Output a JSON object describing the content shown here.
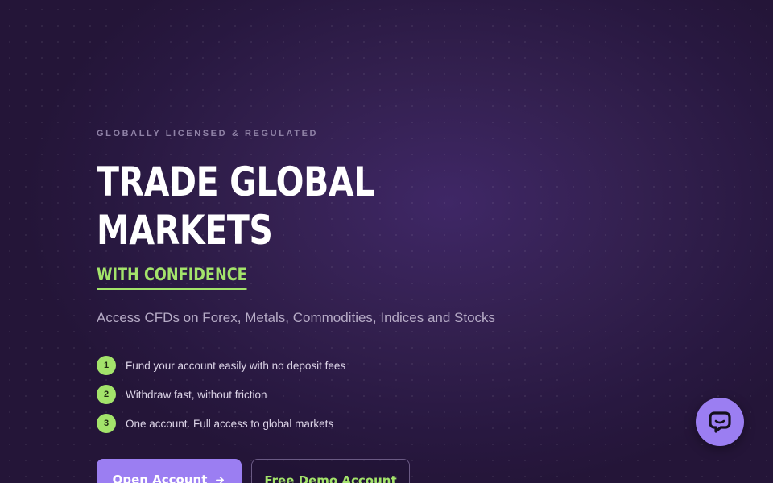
{
  "hero": {
    "eyebrow": "GLOBALLY LICENSED & REGULATED",
    "headline_line1": "TRADE GLOBAL",
    "headline_line2": "MARKETS",
    "tagline": "WITH CONFIDENCE",
    "subtitle": "Access CFDs on Forex, Metals, Commodities, Indices and Stocks",
    "features": [
      {
        "number": "1",
        "text": "Fund your account easily with no deposit fees"
      },
      {
        "number": "2",
        "text": "Withdraw fast, without friction"
      },
      {
        "number": "3",
        "text": "One account. Full access to global markets"
      }
    ],
    "primary_button": {
      "label": "Open Account",
      "icon": "arrow-right-icon"
    },
    "secondary_button": {
      "label": "Free Demo Account"
    }
  },
  "chat": {
    "icon": "chat-bubble-icon"
  },
  "colors": {
    "background": "#2a1a42",
    "accent_green": "#a3e36b",
    "accent_purple": "#9b7ef2",
    "muted_text": "#b6abc6"
  }
}
